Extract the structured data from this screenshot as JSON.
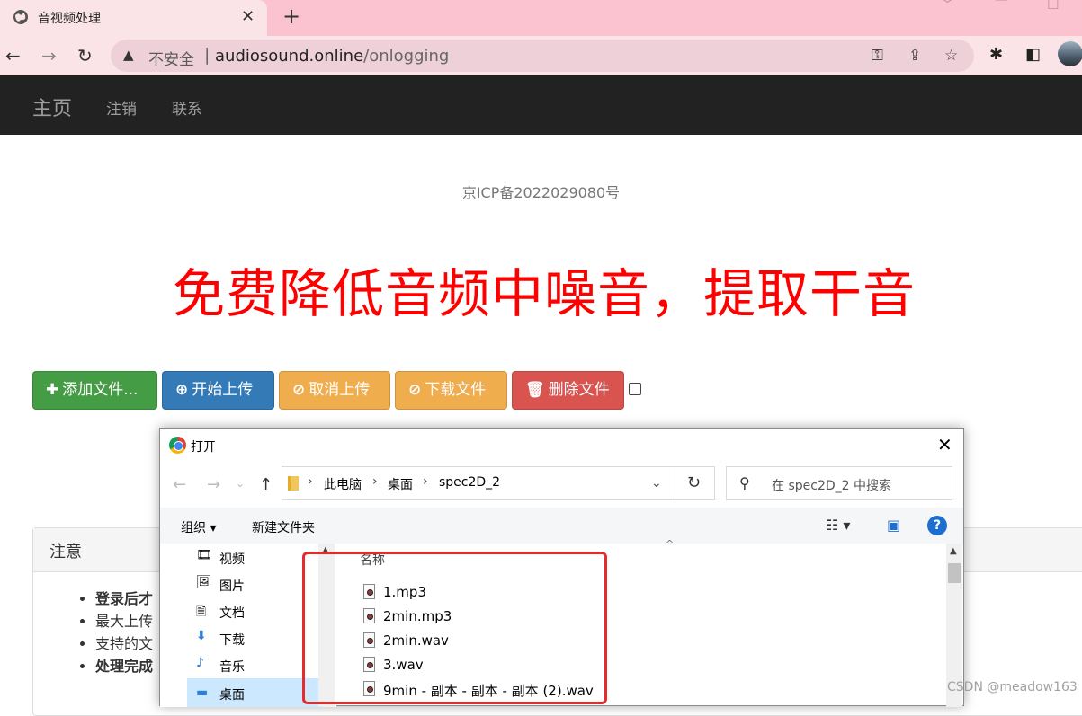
{
  "browser": {
    "tab_title": "音视频处理",
    "new_tab_glyph": "+",
    "tab_close_glyph": "✕",
    "address": {
      "security_label": "不安全",
      "host": "audiosound.online",
      "path": "/onlogging"
    },
    "icons": [
      "globe-icon",
      "back-icon",
      "forward-icon",
      "reload-icon",
      "warning-icon",
      "key-icon",
      "share-icon",
      "star-icon",
      "extensions-icon",
      "sidepanel-icon",
      "profile-avatar"
    ]
  },
  "navbar": {
    "brand": "主页",
    "links": [
      "注销",
      "联系"
    ]
  },
  "page": {
    "icp": "京ICP备2022029080号",
    "headline": "免费降低音频中噪音，提取干音"
  },
  "buttons": {
    "add": "添加文件...",
    "upload": "开始上传",
    "cancel": "取消上传",
    "download": "下载文件",
    "delete": "删除文件"
  },
  "colors": {
    "add": "#449d44",
    "upload": "#337ab7",
    "cancel": "#f0ad4e",
    "download": "#f0ad4e",
    "delete": "#d9534f",
    "headline": "#ff0000",
    "navbar": "#222222",
    "tabstrip": "#fbc3cf"
  },
  "notice": {
    "title": "注意",
    "items": [
      "登录后才",
      "最大上传",
      "支持的文",
      "处理完成"
    ]
  },
  "dialog": {
    "title": "打开",
    "breadcrumb": [
      "此电脑",
      "桌面",
      "spec2D_2"
    ],
    "search_placeholder": "在 spec2D_2 中搜索",
    "organize": "组织 ▾",
    "new_folder": "新建文件夹",
    "help": "?",
    "column_name": "名称",
    "nav_items": [
      {
        "label": "视频",
        "icon": "video-folder-icon"
      },
      {
        "label": "图片",
        "icon": "pictures-folder-icon"
      },
      {
        "label": "文档",
        "icon": "documents-folder-icon"
      },
      {
        "label": "下载",
        "icon": "download-folder-icon"
      },
      {
        "label": "音乐",
        "icon": "music-folder-icon"
      },
      {
        "label": "桌面",
        "icon": "desktop-folder-icon"
      }
    ],
    "files": [
      "1.mp3",
      "2min.mp3",
      "2min.wav",
      "3.wav",
      "9min - 副本 - 副本 - 副本 (2).wav"
    ]
  },
  "watermark": "CSDN @meadow163"
}
